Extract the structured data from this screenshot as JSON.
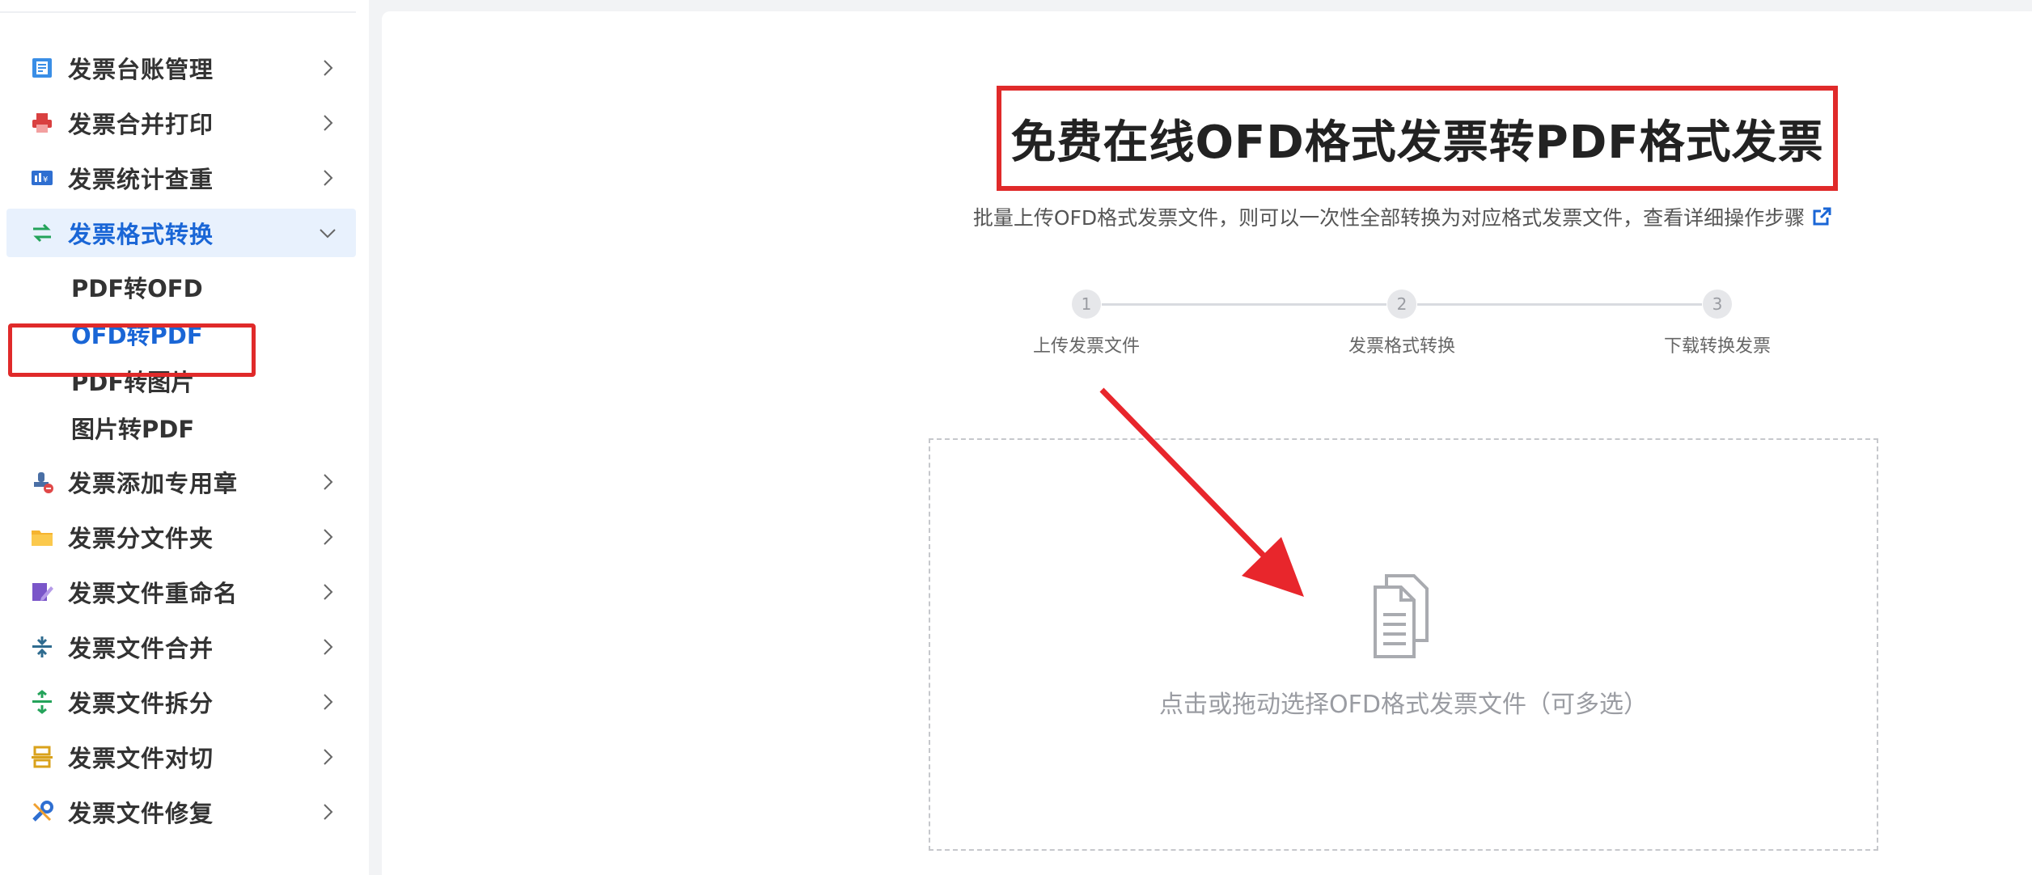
{
  "sidebar": {
    "items": [
      {
        "label": "发票台账管理",
        "icon": "ledger-icon"
      },
      {
        "label": "发票合并打印",
        "icon": "printer-icon"
      },
      {
        "label": "发票统计查重",
        "icon": "statistics-icon"
      },
      {
        "label": "发票格式转换",
        "icon": "convert-icon",
        "active": true
      },
      {
        "label": "发票添加专用章",
        "icon": "stamp-icon"
      },
      {
        "label": "发票分文件夹",
        "icon": "folder-icon"
      },
      {
        "label": "发票文件重命名",
        "icon": "rename-icon"
      },
      {
        "label": "发票文件合并",
        "icon": "merge-icon"
      },
      {
        "label": "发票文件拆分",
        "icon": "split-icon"
      },
      {
        "label": "发票文件对切",
        "icon": "cut-icon"
      },
      {
        "label": "发票文件修复",
        "icon": "repair-icon"
      }
    ],
    "submenu": [
      {
        "label": "PDF转OFD"
      },
      {
        "label": "OFD转PDF",
        "active": true
      },
      {
        "label": "PDF转图片"
      },
      {
        "label": "图片转PDF"
      }
    ]
  },
  "main": {
    "title": "免费在线OFD格式发票转PDF格式发票",
    "subtitle": "批量上传OFD格式发票文件，则可以一次性全部转换为对应格式发票文件，查看详细操作步骤",
    "steps": [
      {
        "num": "1",
        "label": "上传发票文件"
      },
      {
        "num": "2",
        "label": "发票格式转换"
      },
      {
        "num": "3",
        "label": "下载转换发票"
      }
    ],
    "upload": {
      "text": "点击或拖动选择OFD格式发票文件（可多选）"
    }
  },
  "colors": {
    "accent": "#1a66d6",
    "highlight_red": "#e02a2a",
    "active_bg": "#e8f1fd"
  }
}
